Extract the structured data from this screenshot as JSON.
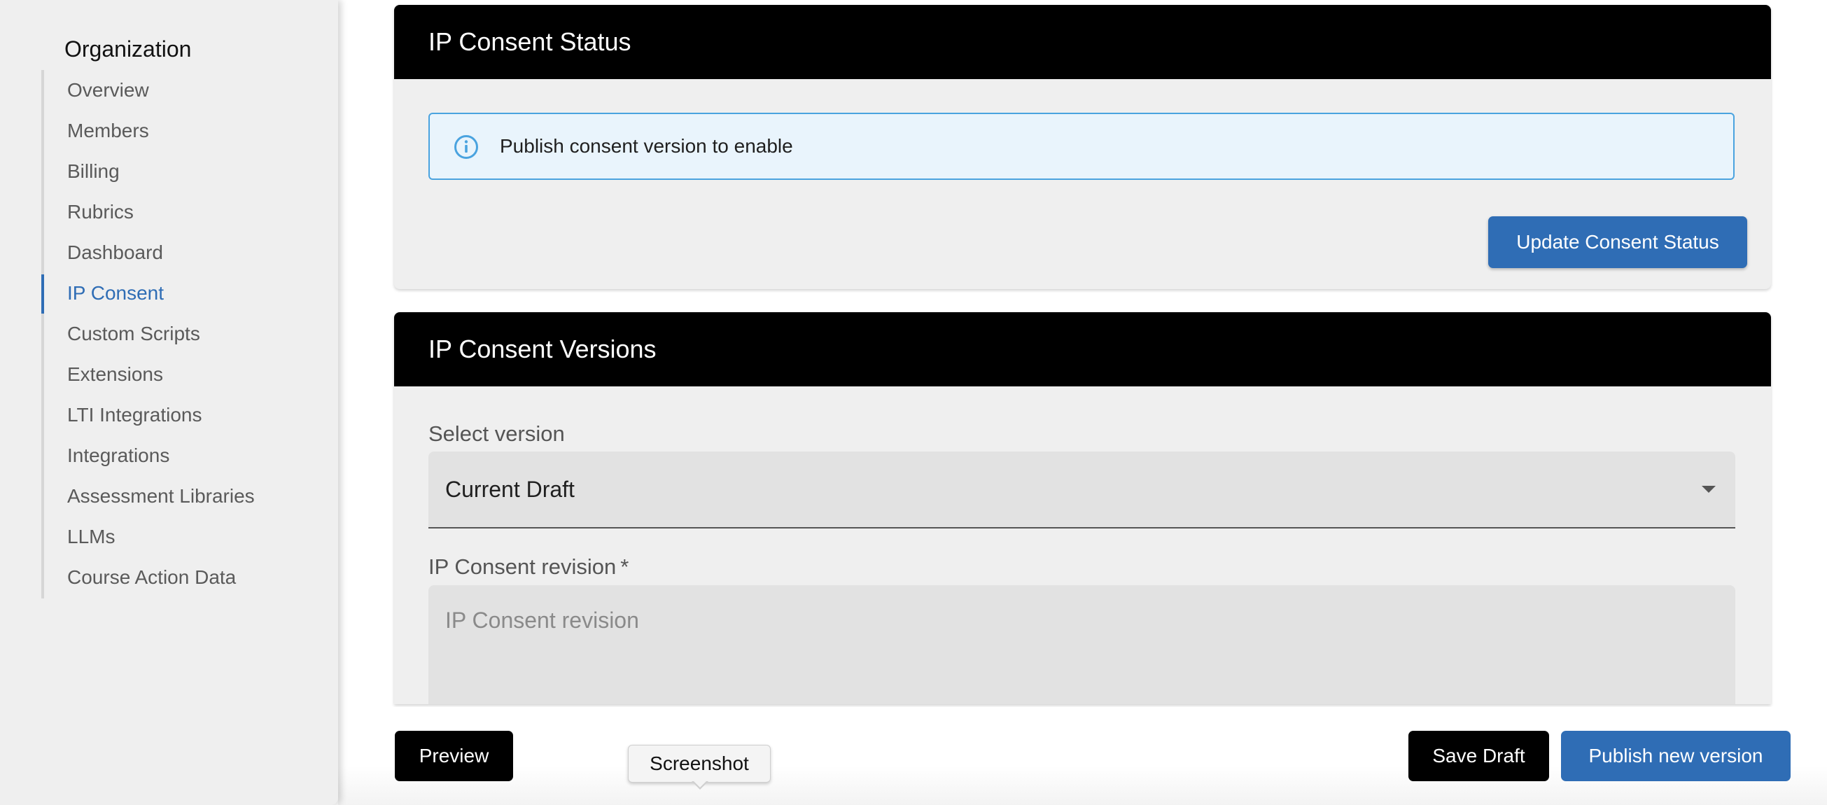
{
  "sidebar": {
    "title": "Organization",
    "items": [
      {
        "label": "Overview"
      },
      {
        "label": "Members"
      },
      {
        "label": "Billing"
      },
      {
        "label": "Rubrics"
      },
      {
        "label": "Dashboard"
      },
      {
        "label": "IP Consent",
        "active": true
      },
      {
        "label": "Custom Scripts"
      },
      {
        "label": "Extensions"
      },
      {
        "label": "LTI Integrations"
      },
      {
        "label": "Integrations"
      },
      {
        "label": "Assessment Libraries"
      },
      {
        "label": "LLMs"
      },
      {
        "label": "Course Action Data"
      }
    ]
  },
  "status_card": {
    "title": "IP Consent Status",
    "alert_icon": "info-icon",
    "alert_text": "Publish consent version to enable",
    "update_button": "Update Consent Status"
  },
  "versions_card": {
    "title": "IP Consent Versions",
    "select_label": "Select version",
    "select_value": "Current Draft",
    "revision_label": "IP Consent revision",
    "revision_required": "*",
    "revision_placeholder": "IP Consent revision",
    "revision_value": ""
  },
  "footer": {
    "preview_button": "Preview",
    "save_draft_button": "Save Draft",
    "publish_button": "Publish new version"
  },
  "tooltip": {
    "text": "Screenshot"
  },
  "colors": {
    "accent": "#2f6db5",
    "header_bg": "#000000",
    "info_border": "#4aa3df",
    "info_bg": "#e9f4fc"
  }
}
